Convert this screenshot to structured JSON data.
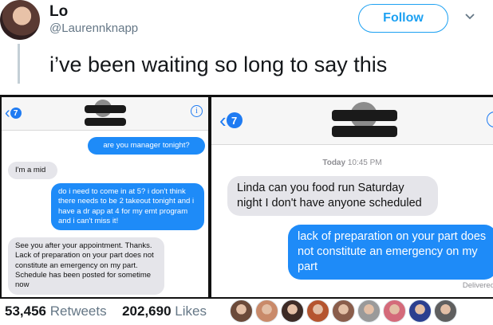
{
  "tweet": {
    "name": "Lo",
    "handle": "@Laurennknapp",
    "follow_label": "Follow",
    "text": "i’ve been waiting so long to say this"
  },
  "left_screenshot": {
    "back_badge": "7",
    "messages": [
      {
        "side": "sent",
        "text": "are you manager tonight?"
      },
      {
        "side": "received",
        "text": "I'm a mid"
      },
      {
        "side": "sent",
        "text": "do i need to come in at 5? i don't think there needs to be 2 takeout tonight and i have a dr app at 4 for my emt program and i can't miss it!"
      },
      {
        "side": "received",
        "text": "See you after your appointment. Thanks. Lack of preparation on your part does not constitute an emergency on my part. Schedule has been posted for sometime now"
      }
    ]
  },
  "right_screenshot": {
    "back_badge": "7",
    "timestamp_day": "Today",
    "timestamp_time": "10:45 PM",
    "messages": [
      {
        "side": "received",
        "text": "Linda can you food run Saturday night I don't have anyone scheduled"
      },
      {
        "side": "sent",
        "text": "lack of preparation on your part does not constitute an emergency on my part"
      }
    ],
    "delivered_label": "Delivered"
  },
  "stats": {
    "retweets_count": "53,456",
    "retweets_label": "Retweets",
    "likes_count": "202,690",
    "likes_label": "Likes"
  },
  "liker_avatar_colors": [
    "#6b4a3a",
    "#c98a6a",
    "#3d2b26",
    "#b5552f",
    "#8a5d4b",
    "#9a9a9a",
    "#d46a7a",
    "#2b3f8f",
    "#5f5f5f"
  ],
  "colors": {
    "twitter_blue": "#1da1f2",
    "imessage_blue": "#1e8bf8",
    "imessage_gray": "#e5e5ea"
  }
}
